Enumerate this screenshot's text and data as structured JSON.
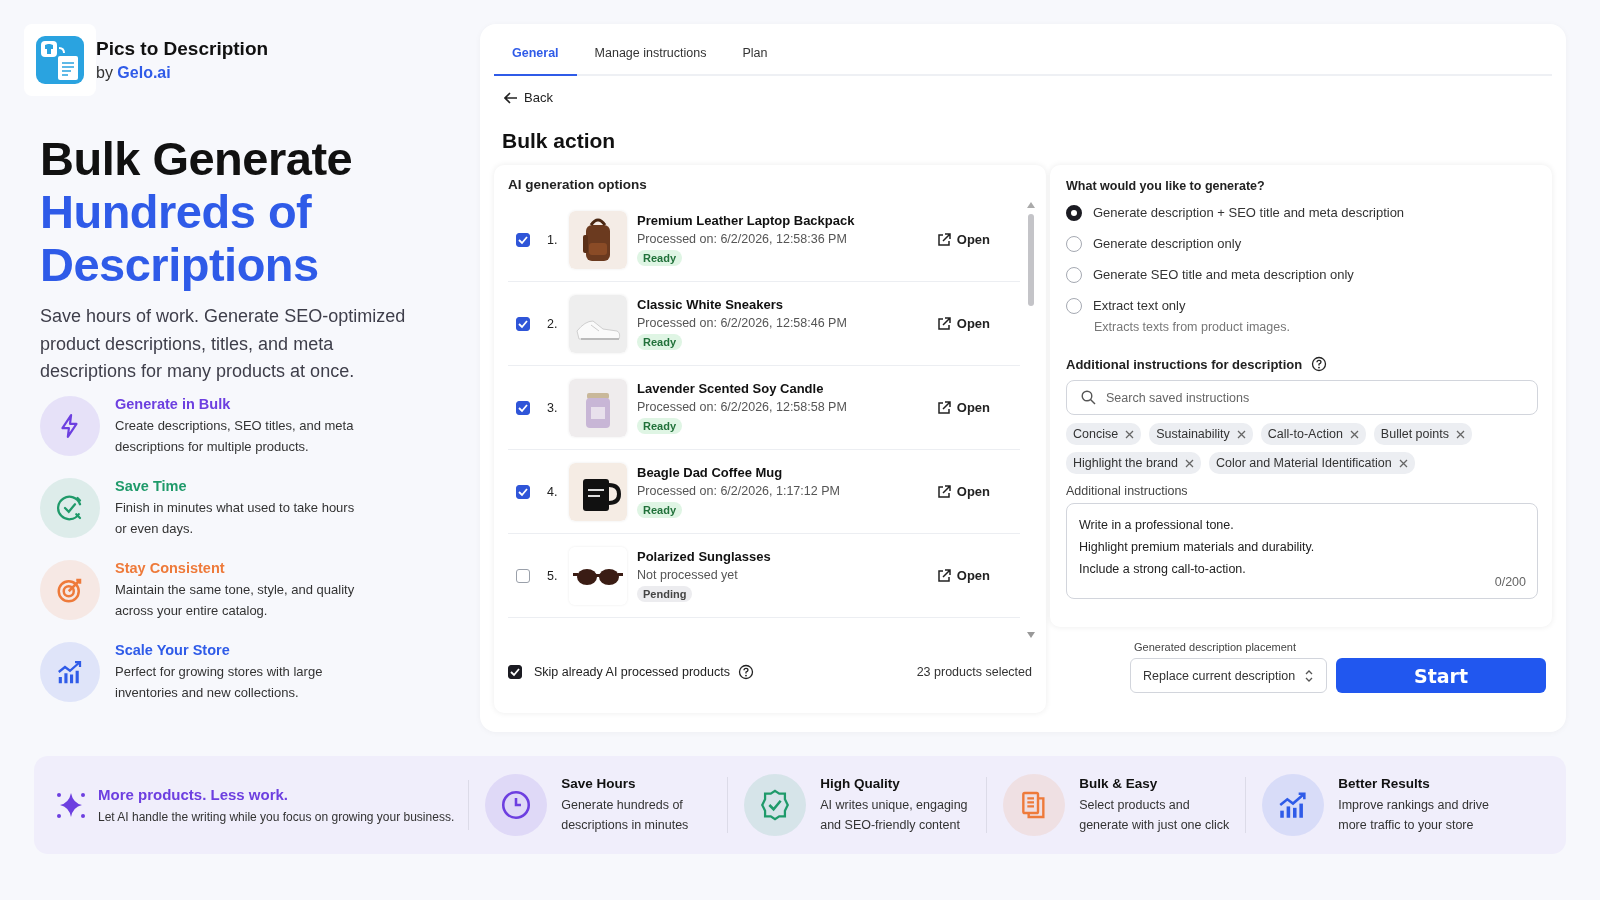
{
  "brand": {
    "name": "Pics to Description",
    "by": "by",
    "by_link": "Gelo.ai"
  },
  "hero": {
    "title": "Bulk Generate",
    "title_accent_1": "Hundreds of",
    "title_accent_2": "Descriptions",
    "subtitle": "Save hours of work. Generate SEO-optimized product descriptions, titles, and meta descriptions for many products at once."
  },
  "features": [
    {
      "title": "Generate in Bulk",
      "text": "Create descriptions, SEO titles, and meta descriptions for multiple products.",
      "color": "#6d3fe0"
    },
    {
      "title": "Save Time",
      "text": "Finish in minutes what used to take hours or even days.",
      "color": "#1f9a6a"
    },
    {
      "title": "Stay Consistent",
      "text": "Maintain the same tone, style, and quality across your entire catalog.",
      "color": "#ee7a3a"
    },
    {
      "title": "Scale Your Store",
      "text": "Perfect for growing stores with large inventories and new collections.",
      "color": "#2f5be8"
    }
  ],
  "tabs": [
    {
      "label": "General",
      "selected": true
    },
    {
      "label": "Manage instructions",
      "selected": false
    },
    {
      "label": "Plan",
      "selected": false
    }
  ],
  "back": "Back",
  "heading": "Bulk action",
  "options_card": {
    "title": "AI generation options",
    "products": [
      {
        "checked": true,
        "open_label": "Open",
        "number": "1.",
        "name": "Premium Leather Laptop Backpack",
        "processed": "Processed on: 6/2/2026, 12:58:36 PM",
        "status": {
          "label": "Ready",
          "kind": "ready"
        }
      },
      {
        "checked": true,
        "open_label": "Open",
        "number": "2.",
        "name": "Classic White Sneakers",
        "processed": "Processed on: 6/2/2026, 12:58:46 PM",
        "status": {
          "label": "Ready",
          "kind": "ready"
        }
      },
      {
        "checked": true,
        "open_label": "Open",
        "number": "3.",
        "name": "Lavender Scented Soy Candle",
        "processed": "Processed on: 6/2/2026, 12:58:58 PM",
        "status": {
          "label": "Ready",
          "kind": "ready"
        }
      },
      {
        "checked": true,
        "open_label": "Open",
        "number": "4.",
        "name": "Beagle Dad Coffee Mug",
        "processed": "Processed on: 6/2/2026, 1:17:12 PM",
        "status": {
          "label": "Ready",
          "kind": "ready"
        }
      },
      {
        "checked": false,
        "open_label": "Open",
        "number": "5.",
        "name": "Polarized Sunglasses",
        "processed": "Not processed yet",
        "status": {
          "label": "Pending",
          "kind": "pending"
        }
      }
    ],
    "skip": {
      "label": "Skip already AI processed products",
      "checked": true
    },
    "selected_count": "23 products selected"
  },
  "generate": {
    "question": "What would you like to generate?",
    "options": [
      {
        "label": "Generate description + SEO title and meta description",
        "selected": true
      },
      {
        "label": "Generate description only",
        "selected": false
      },
      {
        "label": "Generate SEO title and meta description only",
        "selected": false
      },
      {
        "label": "Extract text only",
        "selected": false,
        "note": "Extracts texts from product images."
      }
    ],
    "instructions_title": "Additional instructions for description",
    "search_placeholder": "Search saved instructions",
    "tags": [
      "Concise",
      "Sustainability",
      "Call-to-Action",
      "Bullet points",
      "Highlight the brand",
      "Color and Material Identification"
    ],
    "textarea_label": "Additional instructions",
    "textarea_value": "Write in a professional tone.\nHighlight premium materials and durability.\nInclude a strong call-to-action.",
    "counter": "0/200"
  },
  "placement": {
    "label": "Generated description placement",
    "value": "Replace current description"
  },
  "start": "Start",
  "banner": {
    "headline": "More products. Less work.",
    "subline": "Let AI handle the writing while you focus on growing your business.",
    "items": [
      {
        "title": "Save Hours",
        "text": "Generate hundreds of descriptions in minutes",
        "color": "#6d3fe0"
      },
      {
        "title": "High Quality",
        "text": "AI writes unique, engaging and SEO-friendly content",
        "color": "#1f9a6a"
      },
      {
        "title": "Bulk & Easy",
        "text": "Select products and generate with just one click",
        "color": "#ee7a3a"
      },
      {
        "title": "Better Results",
        "text": "Improve rankings and drive more traffic to your store",
        "color": "#2f5be8"
      }
    ]
  }
}
